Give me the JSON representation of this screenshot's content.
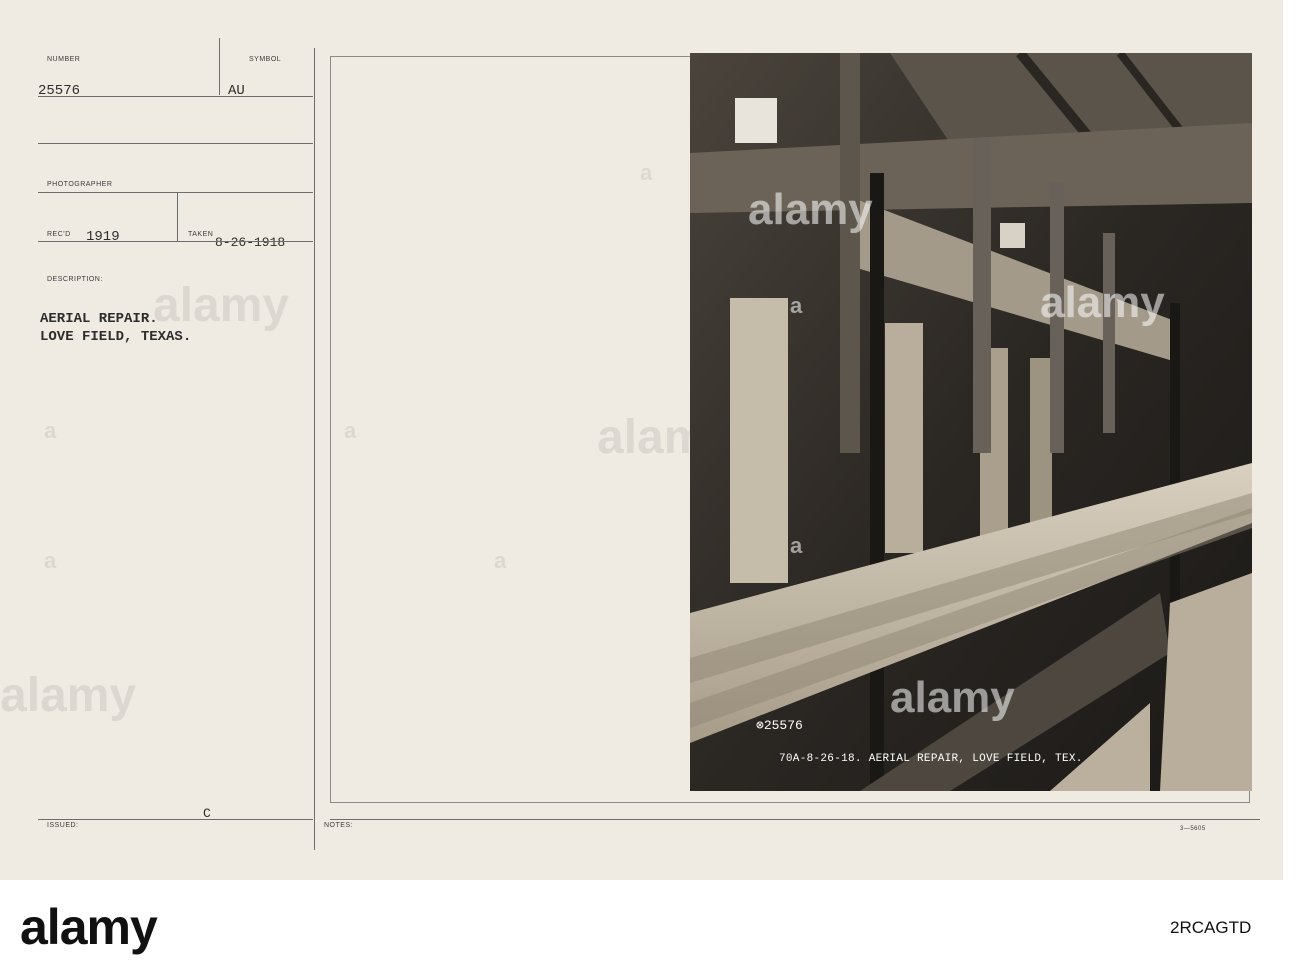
{
  "card": {
    "number_label": "NUMBER",
    "number_value": "25576",
    "symbol_label": "SYMBOL",
    "symbol_value": "AU",
    "photographer_label": "PHOTOGRAPHER",
    "recd_label": "REC'D",
    "recd_value": "1919",
    "taken_label": "TAKEN",
    "taken_value": "8-26-1918",
    "description_label": "DESCRIPTION:",
    "description_line1": "AERIAL REPAIR.",
    "description_line2": "LOVE FIELD, TEXAS.",
    "issued_label": "ISSUED:",
    "issued_mark": "C",
    "notes_label": "NOTES:",
    "form_number": "3—5605"
  },
  "photo": {
    "negative_number": "⊗25576",
    "caption": "70A-8-26-18. AERIAL REPAIR, LOVE FIELD, TEX."
  },
  "watermark": {
    "brand": "alamy",
    "image_id": "2RCAGTD",
    "letter": "a"
  },
  "colors": {
    "card_background": "#f0ebe2",
    "photo_dark": "#2a2622",
    "wood_light": "#c8bda9"
  }
}
